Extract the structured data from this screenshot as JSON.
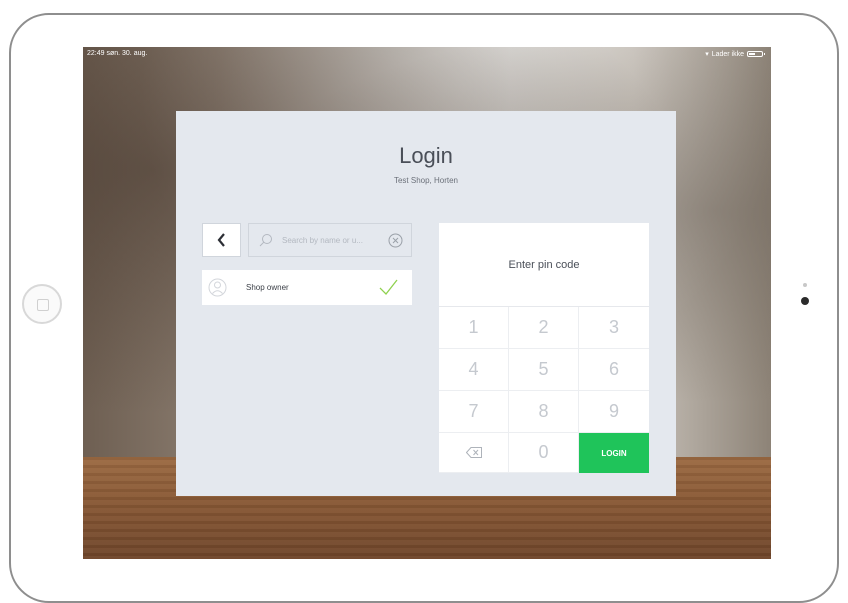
{
  "status_bar": {
    "time_date": "22:49  søn. 30. aug.",
    "charging": "Lader ikke"
  },
  "login": {
    "title": "Login",
    "subtitle": "Test Shop, Horten"
  },
  "search": {
    "placeholder": "Search by name or u..."
  },
  "users": [
    {
      "name": "Shop owner",
      "selected": true
    }
  ],
  "pin": {
    "label": "Enter pin code",
    "keys": [
      "1",
      "2",
      "3",
      "4",
      "5",
      "6",
      "7",
      "8",
      "9",
      "0"
    ],
    "login_label": "LOGIN"
  },
  "colors": {
    "accent": "#1fc45a",
    "panel": "#e4e8ee",
    "check": "#8fd14f"
  }
}
